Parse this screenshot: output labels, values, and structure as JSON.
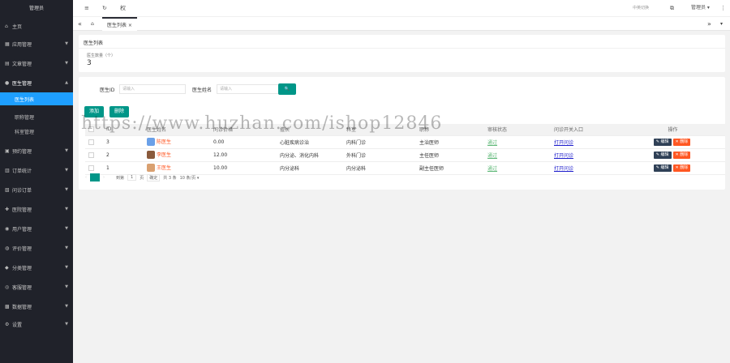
{
  "sidebar": {
    "title": "管理员",
    "items": [
      {
        "label": "主页",
        "icon": "home-icon"
      },
      {
        "label": "应用管理",
        "icon": "grid-icon"
      },
      {
        "label": "文章管理",
        "icon": "file-icon"
      },
      {
        "label": "医生管理",
        "icon": "user-icon"
      },
      {
        "label": "预约管理",
        "icon": "calendar-icon"
      },
      {
        "label": "订单统计",
        "icon": "chart-icon"
      },
      {
        "label": "问诊订单",
        "icon": "order-icon"
      },
      {
        "label": "医院管理",
        "icon": "hospital-icon"
      },
      {
        "label": "用户管理",
        "icon": "users-icon"
      },
      {
        "label": "评价管理",
        "icon": "comment-icon"
      },
      {
        "label": "分类管理",
        "icon": "tag-icon"
      },
      {
        "label": "客服管理",
        "icon": "service-icon"
      },
      {
        "label": "数据管理",
        "icon": "data-icon"
      },
      {
        "label": "设置",
        "icon": "gear-icon"
      }
    ],
    "subitems": [
      "医生列表",
      "职称管理",
      "科室管理"
    ]
  },
  "topbar": {
    "menu_icon": "≡",
    "refresh_icon": "↻",
    "tab_title": "权",
    "right_text": "中英切换",
    "admin": "管理员 ▾",
    "more": "⋮"
  },
  "tabs": {
    "prev": "«",
    "home": "⌂",
    "current": "医生列表 ×",
    "next": "»",
    "dropdown": "▾"
  },
  "summary": {
    "title": "医生列表",
    "count_label": "医生数量（个）",
    "count_value": "3"
  },
  "filters": {
    "id_label": "医生ID",
    "id_placeholder": "请输入",
    "name_label": "医生姓名",
    "name_placeholder": "请输入",
    "search_icon": "🔍"
  },
  "actions": {
    "add": "添加",
    "delete": "删除"
  },
  "table": {
    "headers": [
      "",
      "ID",
      "医生姓名",
      "问诊价格",
      "擅长",
      "科室",
      "职称",
      "审核状态",
      "问诊开关入口",
      "操作"
    ],
    "rows": [
      {
        "id": "3",
        "name": "陈医生",
        "price": "0.00",
        "skill": "心脏疾病诊治",
        "dept": "内科门诊",
        "title": "主治医师",
        "status": "通过",
        "open": "打开问诊",
        "avatar_color": "#6aa0e8"
      },
      {
        "id": "2",
        "name": "李医生",
        "price": "12.00",
        "skill": "内分泌、消化内科",
        "dept": "外科门诊",
        "title": "主任医师",
        "status": "通过",
        "open": "打开问诊",
        "avatar_color": "#8a5a3c"
      },
      {
        "id": "1",
        "name": "王医生",
        "price": "10.00",
        "skill": "内分泌科",
        "dept": "内分泌科",
        "title": "副主任医师",
        "status": "通过",
        "open": "打开问诊",
        "avatar_color": "#d9a070"
      }
    ],
    "edit_label": "✎ 编辑",
    "del_label": "✕ 删除"
  },
  "pager": {
    "prev": "‹",
    "page": "1",
    "next": "›",
    "goto_text": "到第",
    "page_unit": "页",
    "confirm": "确定",
    "total": "共 3 条",
    "per_page": "10 条/页 ▾"
  },
  "watermark": "https://www.huzhan.com/ishop12846",
  "colors": {
    "sidebar_bg": "#20222a",
    "active_blue": "#1e9fff",
    "primary_green": "#009688",
    "danger_orange": "#ff5722",
    "edit_dark": "#2f4056"
  }
}
